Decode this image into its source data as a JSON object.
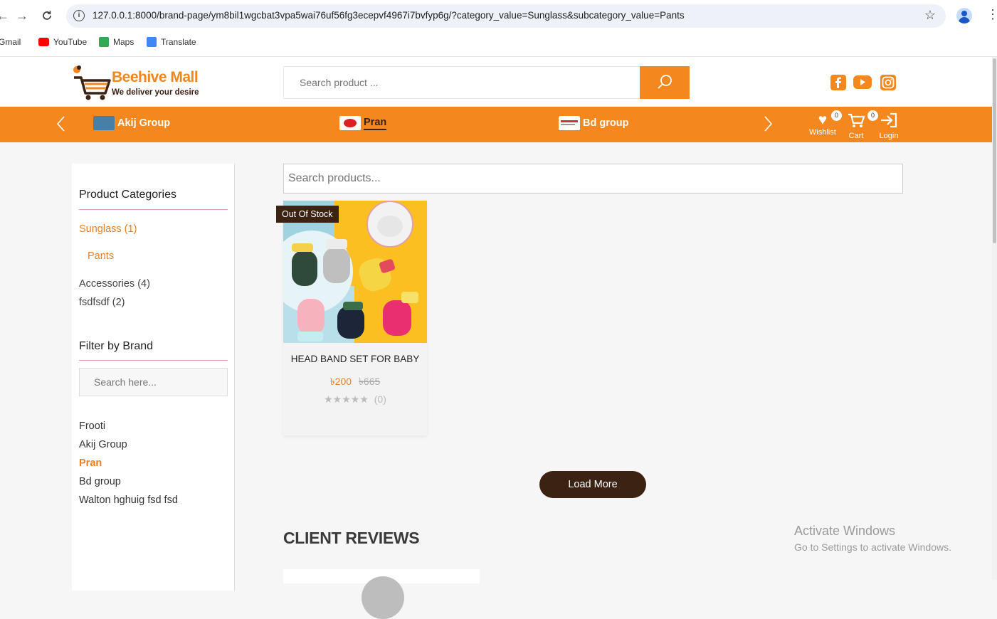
{
  "browser": {
    "url": "127.0.0.1:8000/brand-page/ym8bil1wgcbat3vpa5wai76uf56fg3ecepvf4967i7bvfyp6g/?category_value=Sunglass&subcategory_value=Pants",
    "back_icon": "arrow-left-icon",
    "forward_icon": "arrow-right-icon",
    "reload_icon": "reload-icon",
    "bookmarks": [
      {
        "label": "Gmail",
        "icon": "gmail-icon",
        "color": "#d93025"
      },
      {
        "label": "YouTube",
        "icon": "youtube-icon",
        "color": "#ff0000"
      },
      {
        "label": "Maps",
        "icon": "maps-icon",
        "color": "#34a853"
      },
      {
        "label": "Translate",
        "icon": "translate-icon",
        "color": "#4285f4"
      }
    ]
  },
  "header": {
    "logo_title": "Beehive Mall",
    "logo_tagline": "We deliver your desire",
    "search_placeholder": "Search product ...",
    "social": [
      "facebook-icon",
      "youtube-icon",
      "instagram-icon"
    ],
    "accent_color": "#f5871f",
    "dark_color": "#3b2212"
  },
  "brand_bar": {
    "brands": [
      {
        "label": "Akij Group",
        "active": false
      },
      {
        "label": "Pran",
        "active": true
      },
      {
        "label": "Bd group",
        "active": false
      }
    ],
    "wishlist": {
      "label": "Wishlist",
      "count": "0"
    },
    "cart": {
      "label": "Cart",
      "count": "0"
    },
    "login": {
      "label": "Login"
    }
  },
  "sidebar": {
    "categories_title": "Product Categories",
    "categories": [
      {
        "label": "Sunglass (1)",
        "active": true
      },
      {
        "label": "Pants",
        "active": true,
        "sub": true
      },
      {
        "label": "Accessories (4)",
        "active": false
      },
      {
        "label": "fsdfsdf (2)",
        "active": false
      }
    ],
    "brand_title": "Filter by Brand",
    "brand_search_placeholder": "Search here...",
    "brands": [
      {
        "label": "Frooti",
        "active": false
      },
      {
        "label": "Akij Group",
        "active": false
      },
      {
        "label": "Pran",
        "active": true
      },
      {
        "label": "Bd group",
        "active": false
      },
      {
        "label": "Walton hghuig fsd fsd",
        "active": false
      }
    ]
  },
  "main": {
    "search_placeholder": "Search products...",
    "products": [
      {
        "badge": "Out Of Stock",
        "title": "HEAD BAND SET FOR BABY",
        "price": "৳200",
        "old_price": "৳665",
        "rating": 0,
        "stars": "★★★★★",
        "reviews": "(0)"
      }
    ],
    "load_more": "Load More",
    "reviews_title": "CLIENT REVIEWS"
  },
  "os_watermark": {
    "line1": "Activate Windows",
    "line2": "Go to Settings to activate Windows."
  }
}
